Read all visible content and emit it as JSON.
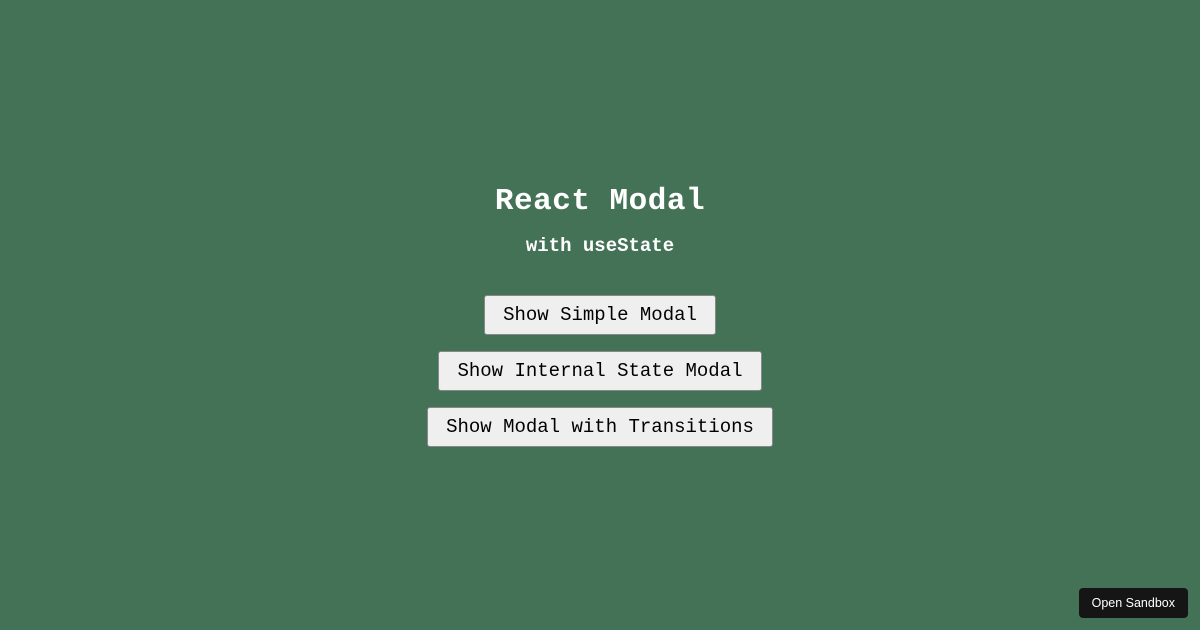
{
  "heading": {
    "title": "React Modal",
    "subtitle": "with useState"
  },
  "buttons": {
    "simple": "Show Simple Modal",
    "internal": "Show Internal State Modal",
    "transitions": "Show Modal with Transitions"
  },
  "sandbox": {
    "label": "Open Sandbox"
  }
}
